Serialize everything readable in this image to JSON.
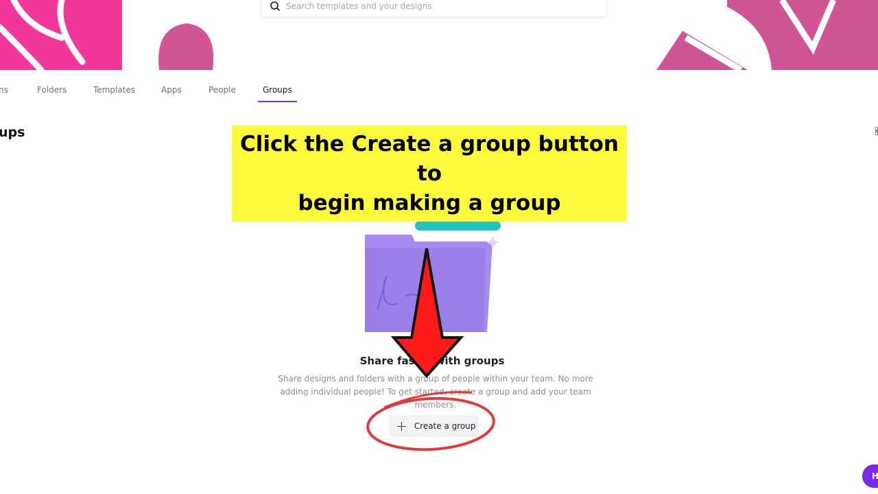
{
  "search": {
    "placeholder": "Search templates and your designs",
    "icon": "search-icon"
  },
  "tabs": [
    {
      "label": "ns"
    },
    {
      "label": "Folders"
    },
    {
      "label": "Templates"
    },
    {
      "label": "Apps"
    },
    {
      "label": "People"
    },
    {
      "label": "Groups",
      "active": true
    }
  ],
  "page": {
    "title": "ups"
  },
  "callout": {
    "line1": "Click the Create a group button to",
    "line2": "begin making a group"
  },
  "empty_state": {
    "title": "Share faster with groups",
    "description": "Share designs and folders with a group of people within your team. No more adding individual people! To get started, create a group and add your team members.",
    "button_label": "Create a group"
  },
  "help": {
    "label": "H"
  },
  "colors": {
    "accent": "#7d2ae8",
    "banner_pink": "#f2379b",
    "banner_mauve": "#d05595",
    "callout": "#fdfa3b",
    "arrow": "#ff1a1a",
    "circle": "#e03a3a"
  }
}
